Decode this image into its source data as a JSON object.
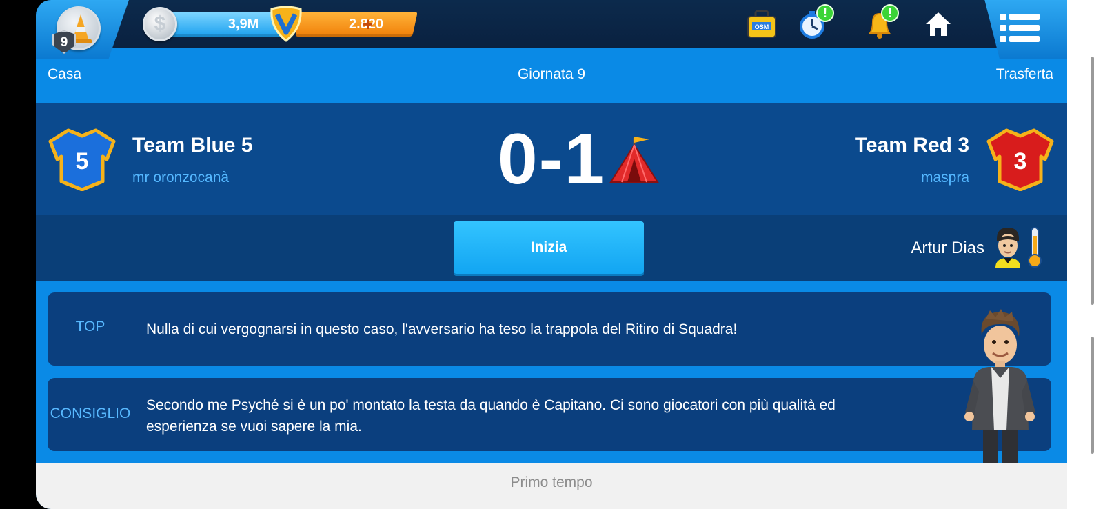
{
  "topbar": {
    "level": "9",
    "money": "3,9M",
    "credits": "2.820",
    "money_symbol": "$",
    "plus_symbol": "+",
    "osm_label": "OSM",
    "alert_mark": "!"
  },
  "match": {
    "home_label": "Casa",
    "round_label": "Giornata 9",
    "away_label": "Trasferta",
    "home_team": "Team Blue 5",
    "home_manager": "mr oronzocanà",
    "home_shirt_number": "5",
    "away_team": "Team Red 3",
    "away_manager": "maspra",
    "away_shirt_number": "3",
    "score": "0-1",
    "start_label": "Inizia",
    "referee": "Artur Dias"
  },
  "tips": [
    {
      "tag": "TOP",
      "text": "Nulla di cui vergognarsi in questo caso, l'avversario ha teso la trappola del Ritiro di Squadra!"
    },
    {
      "tag": "CONSIGLIO",
      "text": "Secondo me Psyché si è un po' montato la testa da quando è Capitano. Ci sono giocatori con più qualità ed esperienza se vuoi sapere la mia."
    }
  ],
  "footer": {
    "period": "Primo tempo"
  },
  "colors": {
    "primary_blue": "#0a8ae6",
    "dark_blue": "#0b4a8e",
    "card_blue": "#0b3f7e",
    "topbar": "#0c2a4c",
    "button_blue": "#12a5f2",
    "accent_light_blue": "#58b9ff",
    "money_pill": "#1aa0ef",
    "credit_pill": "#f07f08",
    "alert_green": "#3bd437"
  },
  "icons": {
    "level": "traffic-cone-icon",
    "money": "silver-coin-icon",
    "credits": "gold-shield-icon",
    "shop": "osm-bag-icon",
    "timer": "stopwatch-icon",
    "notifications": "bell-icon",
    "home": "house-icon",
    "menu": "list-menu-icon",
    "tactic": "tent-icon",
    "referee": "referee-avatar-icon",
    "referee_strictness": "thermometer-icon"
  }
}
